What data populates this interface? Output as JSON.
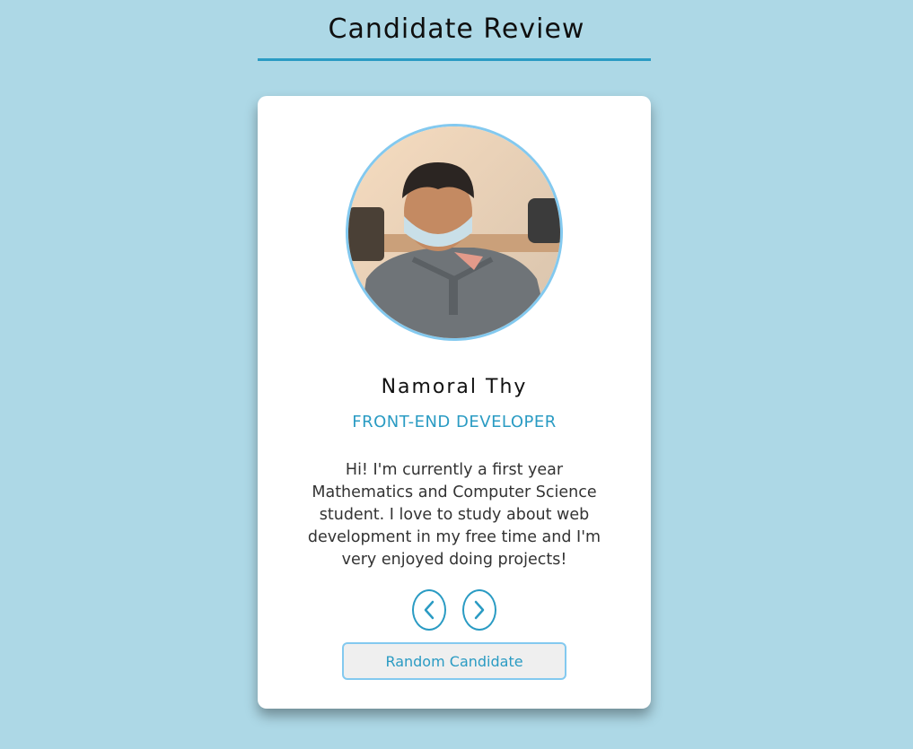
{
  "header": {
    "title": "Candidate Review",
    "accent_color": "#2a9bc3"
  },
  "candidate": {
    "name": "Namoral Thy",
    "role": "FRONT-END DEVELOPER",
    "bio": "Hi! I'm currently a first year Mathematics and Computer Science student. I love to study about web development in my free time and I'm very enjoyed doing projects!",
    "photo_icon": "candidate-photo"
  },
  "controls": {
    "prev_icon": "chevron-left-icon",
    "next_icon": "chevron-right-icon",
    "random_label": "Random Candidate"
  },
  "colors": {
    "background": "#add8e6",
    "card": "#ffffff",
    "accent": "#2a9bc3",
    "avatar_border": "#83c9ef"
  }
}
